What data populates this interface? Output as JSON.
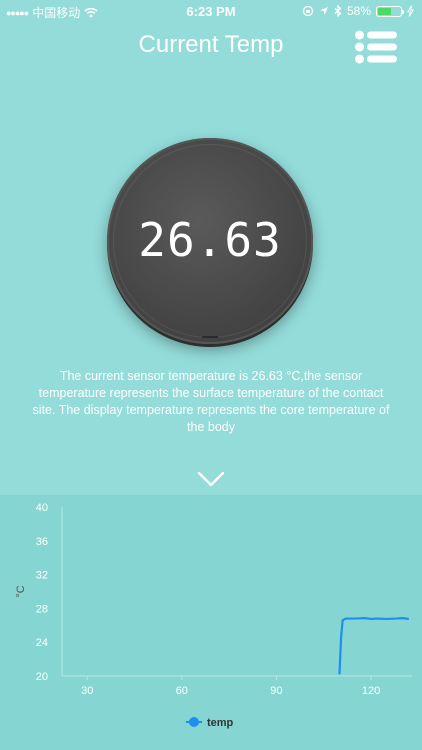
{
  "status_bar": {
    "carrier": "中国移动",
    "time": "6:23 PM",
    "battery_percent": "58%",
    "battery_level": 0.58
  },
  "header": {
    "title": "Current Temp"
  },
  "display": {
    "value": "26.63"
  },
  "description": "The current sensor temperature is 26.63 °C,the sensor temperature represents the surface temperature of the contact site. The display temperature represents the core temperature of the body",
  "colors": {
    "background": "#93dcd9",
    "chart_background": "#85d6d3",
    "series_line": "#1e8ef0",
    "battery": "#4cd964"
  },
  "chart_data": {
    "type": "line",
    "ylabel": "°C",
    "xlabel": "",
    "ylim": [
      20,
      40
    ],
    "xlim": [
      22,
      133
    ],
    "y_ticks": [
      20,
      24,
      28,
      32,
      36,
      40
    ],
    "x_ticks": [
      30,
      60,
      90,
      120
    ],
    "grid": false,
    "legend_position": "bottom-center",
    "series": [
      {
        "name": "temp",
        "x": [
          110,
          110.5,
          111,
          112,
          115,
          118,
          120,
          122,
          125,
          128,
          130,
          132
        ],
        "y": [
          20.2,
          24.5,
          26.6,
          26.8,
          26.8,
          26.85,
          26.75,
          26.8,
          26.75,
          26.8,
          26.85,
          26.75
        ]
      }
    ]
  }
}
